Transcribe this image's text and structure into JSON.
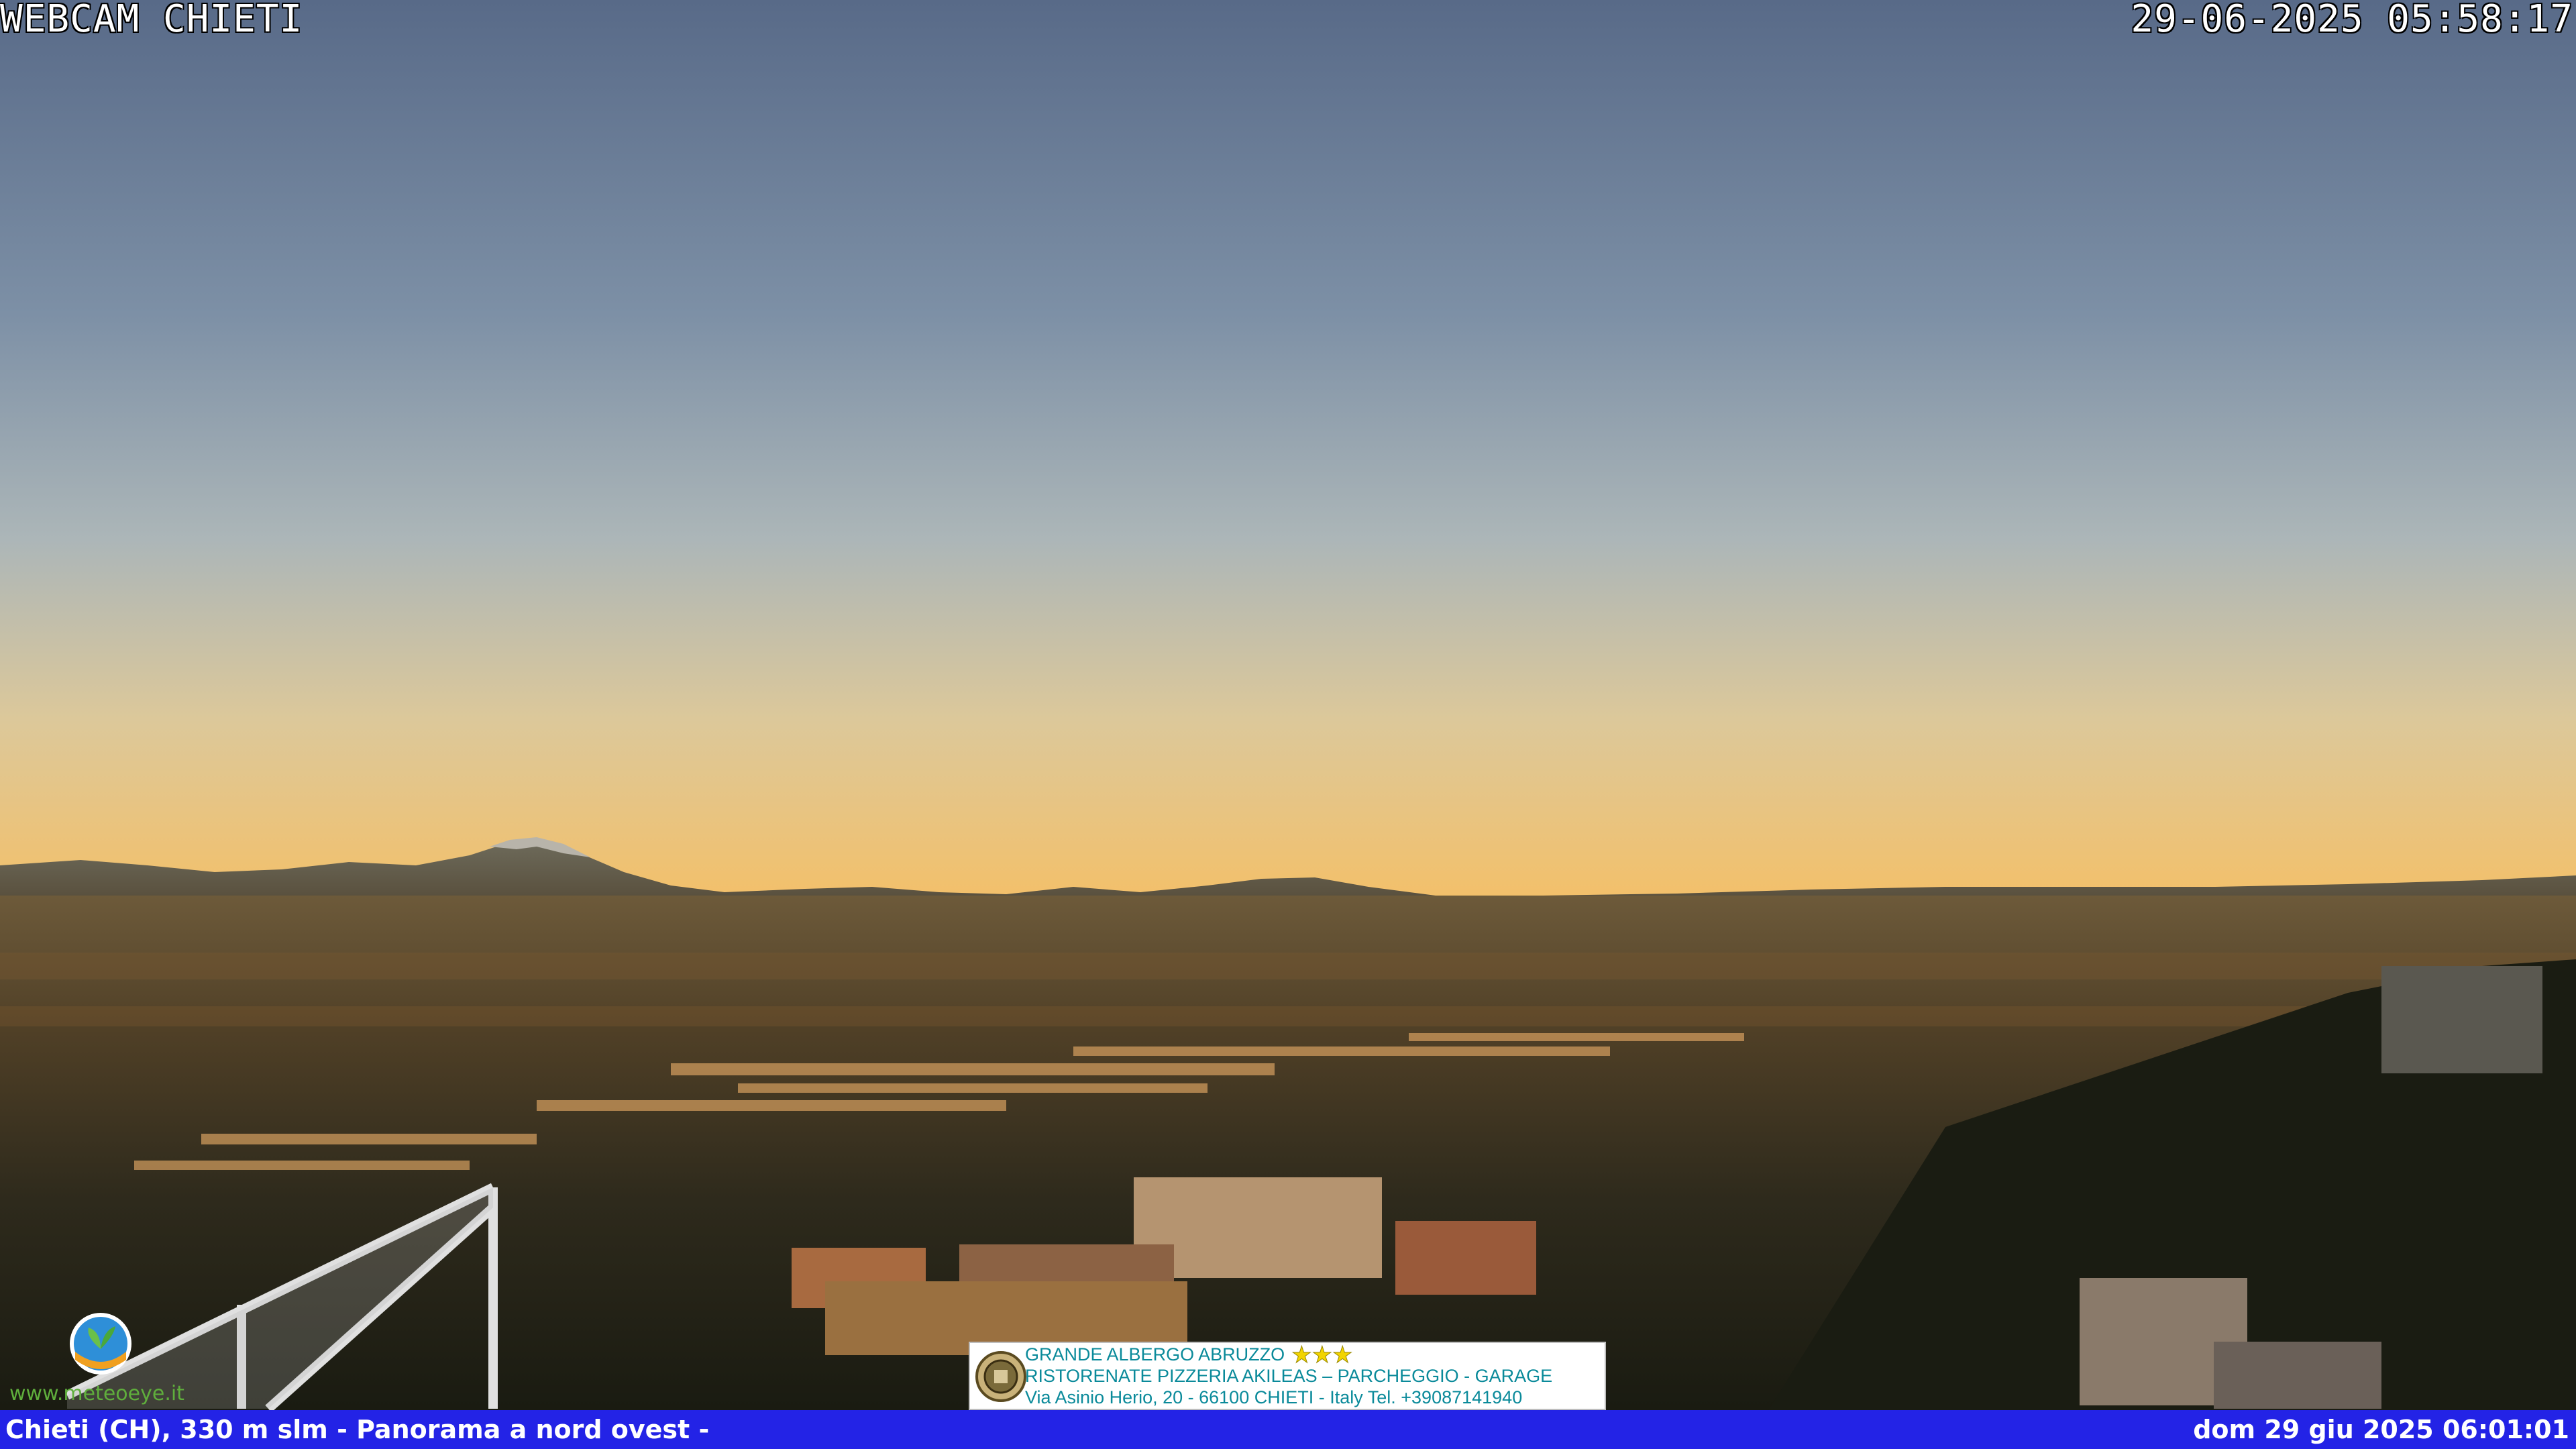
{
  "overlay": {
    "title": "WEBCAM CHIETI",
    "timestamp": "29-06-2025 05:58:17"
  },
  "footer": {
    "location": "Chieti (CH), 330 m slm - Panorama a nord ovest -",
    "datetime": "dom 29 giu 2025 06:01:01"
  },
  "ad": {
    "line1": "GRANDE ALBERGO ABRUZZO",
    "stars": "★★★",
    "line2": "RISTORENATE PIZZERIA AKILEAS – PARCHEGGIO - GARAGE",
    "line3": "Via Asinio Herio, 20 - 66100 CHIETI - Italy Tel. +39087141940"
  },
  "logo": {
    "text": "www.meteoeye.it",
    "icon": "meteo-logo-icon"
  },
  "colors": {
    "sky_top": "#5a6c8a",
    "sky_mid": "#9aaab4",
    "horizon": "#f0c070",
    "footer_bar": "#2323e6",
    "ad_text": "#0a8a9a"
  }
}
